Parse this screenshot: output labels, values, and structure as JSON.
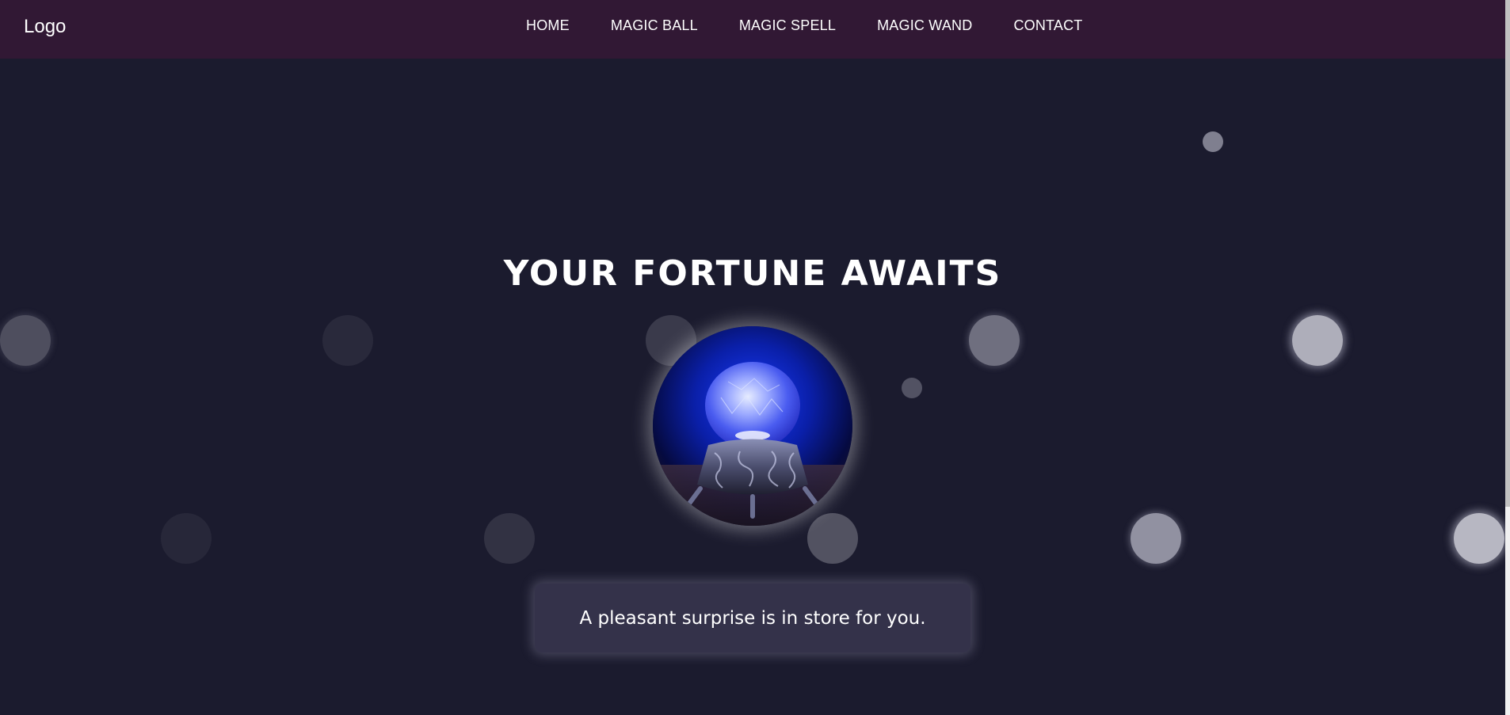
{
  "navbar": {
    "logo": "Logo",
    "links": [
      {
        "label": "HOME"
      },
      {
        "label": "MAGIC BALL"
      },
      {
        "label": "MAGIC SPELL"
      },
      {
        "label": "MAGIC WAND"
      },
      {
        "label": "CONTACT"
      }
    ]
  },
  "hero": {
    "title": "YOUR FORTUNE AWAITS",
    "fortune": "A pleasant surprise is in store for you."
  },
  "colors": {
    "navbar_bg": "#311834",
    "page_bg": "#1b1b2e",
    "fortune_box_bg": "#34324a",
    "text": "#ffffff"
  },
  "icons": {
    "crystal_ball": "crystal-ball-image"
  }
}
